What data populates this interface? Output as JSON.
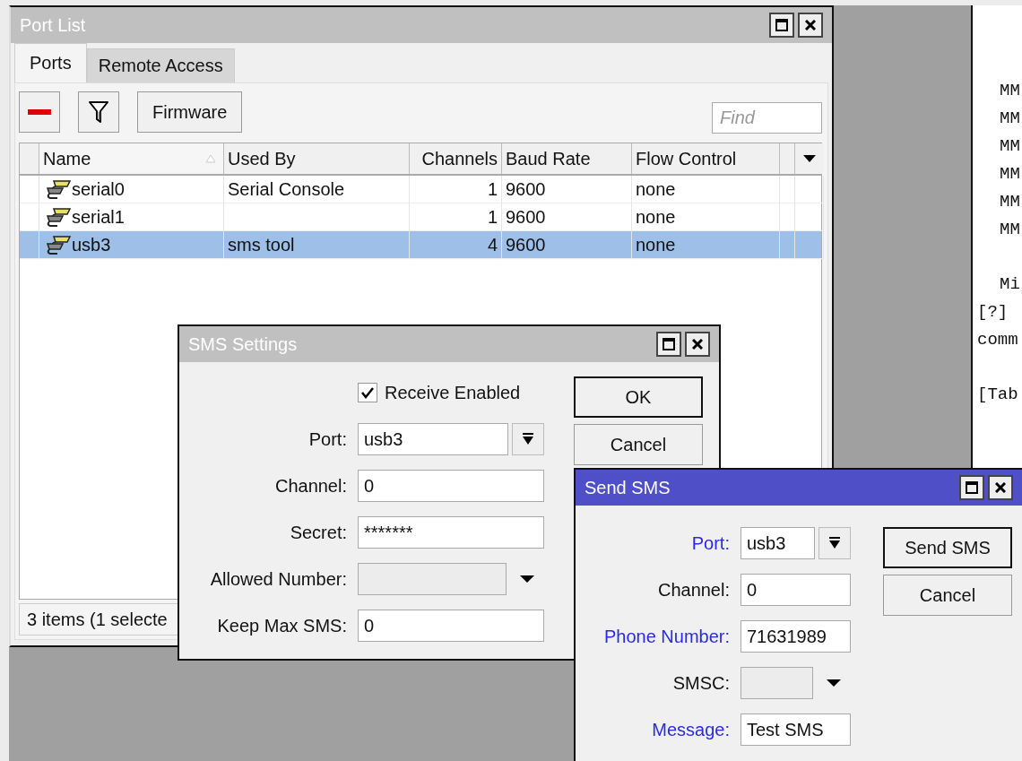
{
  "terminal": {
    "blocks": [
      {
        "lines": [
          {
            "text": "MM",
            "kind": "indented"
          },
          {
            "text": "MM",
            "kind": "indented"
          },
          {
            "text": "MM",
            "kind": "indented"
          },
          {
            "text": "MM",
            "kind": "indented"
          },
          {
            "text": "MM",
            "kind": "indented"
          },
          {
            "text": "MM",
            "kind": "indented"
          }
        ]
      },
      {
        "lines": [
          {
            "text": "Mi",
            "kind": "indented"
          },
          {
            "text": "[?]",
            "kind": "plain"
          },
          {
            "text": "comm",
            "kind": "plain"
          }
        ]
      },
      {
        "lines": [
          {
            "text": "[Tab",
            "kind": "plain"
          }
        ]
      }
    ]
  },
  "port_list": {
    "title": "Port List",
    "active": false,
    "tabs": [
      {
        "label": "Ports",
        "selected": true
      },
      {
        "label": "Remote Access",
        "selected": false
      }
    ],
    "toolbar": [
      {
        "kind": "remove"
      },
      {
        "kind": "filter"
      },
      {
        "kind": "text",
        "label": "Firmware"
      }
    ],
    "find": {
      "placeholder": "Find"
    },
    "table": {
      "columns": [
        {
          "label": "Name",
          "sorted": true
        },
        {
          "label": "Used By",
          "sorted": false
        },
        {
          "label": "Channels",
          "sorted": false
        },
        {
          "label": "Baud Rate",
          "sorted": false
        },
        {
          "label": "Flow Control",
          "sorted": false
        }
      ],
      "rows": [
        {
          "name": "serial0",
          "used_by": "Serial Console",
          "channels": "1",
          "baud_rate": "9600",
          "flow_control": "none",
          "selected": false
        },
        {
          "name": "serial1",
          "used_by": "",
          "channels": "1",
          "baud_rate": "9600",
          "flow_control": "none",
          "selected": false
        },
        {
          "name": "usb3",
          "used_by": "sms tool",
          "channels": "4",
          "baud_rate": "9600",
          "flow_control": "none",
          "selected": true
        }
      ]
    },
    "status_bar": "3 items (1 selecte"
  },
  "sms_settings": {
    "title": "SMS Settings",
    "active": false,
    "receive_enabled": {
      "label": "Receive Enabled",
      "checked": true
    },
    "fields": [
      {
        "label": "Port:",
        "value": "usb3",
        "kind": "select",
        "required": false
      },
      {
        "label": "Channel:",
        "value": "0",
        "kind": "text",
        "required": false
      },
      {
        "label": "Secret:",
        "value": "*******",
        "kind": "text",
        "required": false
      },
      {
        "label": "Allowed Number:",
        "kind": "combo",
        "required": false
      },
      {
        "label": "Keep Max SMS:",
        "value": "0",
        "kind": "text",
        "required": false
      }
    ],
    "buttons": [
      {
        "label": "OK",
        "default": true
      },
      {
        "label": "Cancel",
        "default": false
      }
    ]
  },
  "send_sms": {
    "title": "Send SMS",
    "active": true,
    "fields": [
      {
        "label": "Port:",
        "value": "usb3",
        "kind": "select",
        "required": true
      },
      {
        "label": "Channel:",
        "value": "0",
        "kind": "text",
        "required": false
      },
      {
        "label": "Phone Number:",
        "value": "71631989",
        "kind": "text",
        "required": true
      },
      {
        "label": "SMSC:",
        "kind": "combo",
        "required": false
      },
      {
        "label": "Message:",
        "value": "Test SMS",
        "kind": "text",
        "required": true
      }
    ],
    "buttons": [
      {
        "label": "Send SMS",
        "default": true
      },
      {
        "label": "Cancel",
        "default": false
      }
    ]
  }
}
